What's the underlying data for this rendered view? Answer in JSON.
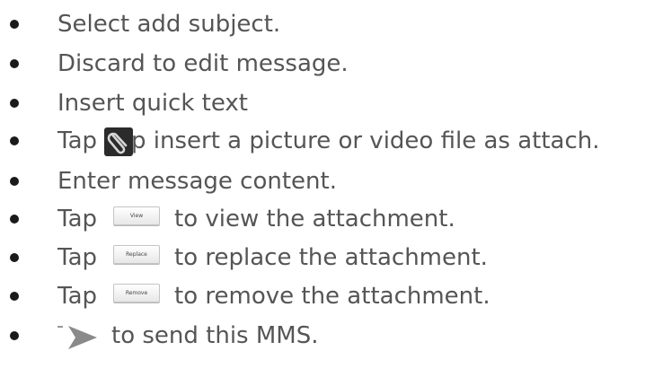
{
  "items": [
    {
      "text": "Select add subject."
    },
    {
      "text": "Discard to edit message."
    },
    {
      "text": "Insert quick text"
    },
    {
      "before": "Tap",
      "after": "p insert a picture or video file as attach.",
      "icon": "paperclip-icon"
    },
    {
      "text": "Enter message content."
    },
    {
      "before": "Tap",
      "button": "View",
      "after": "to view the attachment."
    },
    {
      "before": "Tap",
      "button": "Replace",
      "after": "to replace the attachment."
    },
    {
      "before": "Tap",
      "button": "Remove",
      "after": "to remove the attachment."
    },
    {
      "before": "T",
      "after": "to send this MMS.",
      "icon": "send-arrow-icon"
    }
  ],
  "colors": {
    "text": "#555555",
    "bullet": "#1a1a1a",
    "icon_bg": "#2b2b2b",
    "send_arrow": "#8a8a8a"
  }
}
